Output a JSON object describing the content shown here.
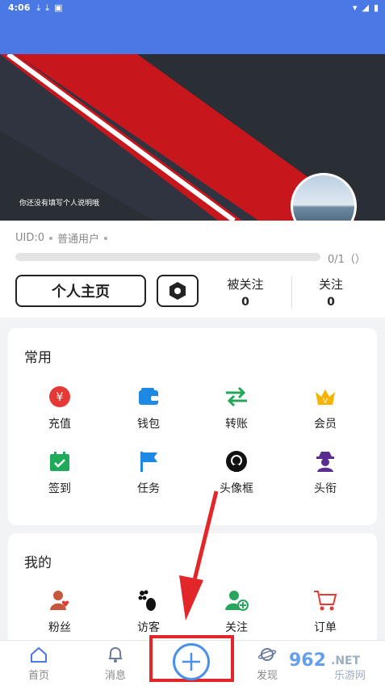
{
  "status_bar": {
    "time": "4:06"
  },
  "banner": {
    "intro_text": "你还没有填写个人说明哦"
  },
  "profile": {
    "uid": "UID:0",
    "user_type": "普通用户",
    "progress_text": "0/1（）",
    "progress_fraction": 0
  },
  "actions": {
    "home_button": "个人主页",
    "followers_label": "被关注",
    "followers_count": "0",
    "following_label": "关注",
    "following_count": "0"
  },
  "common": {
    "title": "常用",
    "items": [
      {
        "label": "充值",
        "icon": "yuan-coin-icon",
        "color": "#e53935"
      },
      {
        "label": "钱包",
        "icon": "wallet-icon",
        "color": "#1e88e5"
      },
      {
        "label": "转账",
        "icon": "transfer-arrows-icon",
        "color": "#26a65b"
      },
      {
        "label": "会员",
        "icon": "crown-icon",
        "color": "#f6b400"
      },
      {
        "label": "签到",
        "icon": "calendar-check-icon",
        "color": "#1faa59"
      },
      {
        "label": "任务",
        "icon": "flag-icon",
        "color": "#1e88e5"
      },
      {
        "label": "头像框",
        "icon": "github-icon",
        "color": "#111111"
      },
      {
        "label": "头衔",
        "icon": "spy-icon",
        "color": "#5b2c8f"
      }
    ]
  },
  "mine": {
    "title": "我的",
    "items": [
      {
        "label": "粉丝",
        "icon": "fans-icon",
        "color": "#c8553d"
      },
      {
        "label": "访客",
        "icon": "footprint-icon",
        "color": "#111111"
      },
      {
        "label": "关注",
        "icon": "user-plus-icon",
        "color": "#26a65b"
      },
      {
        "label": "订单",
        "icon": "cart-icon",
        "color": "#e53935"
      }
    ]
  },
  "bottom_nav": {
    "home": "首页",
    "messages": "消息",
    "discover": "发现"
  },
  "watermark": {
    "brand": "962",
    "tld": ".NET",
    "sub": "乐游网"
  },
  "colors": {
    "accent": "#4a79e6",
    "highlight": "#e3262a"
  }
}
